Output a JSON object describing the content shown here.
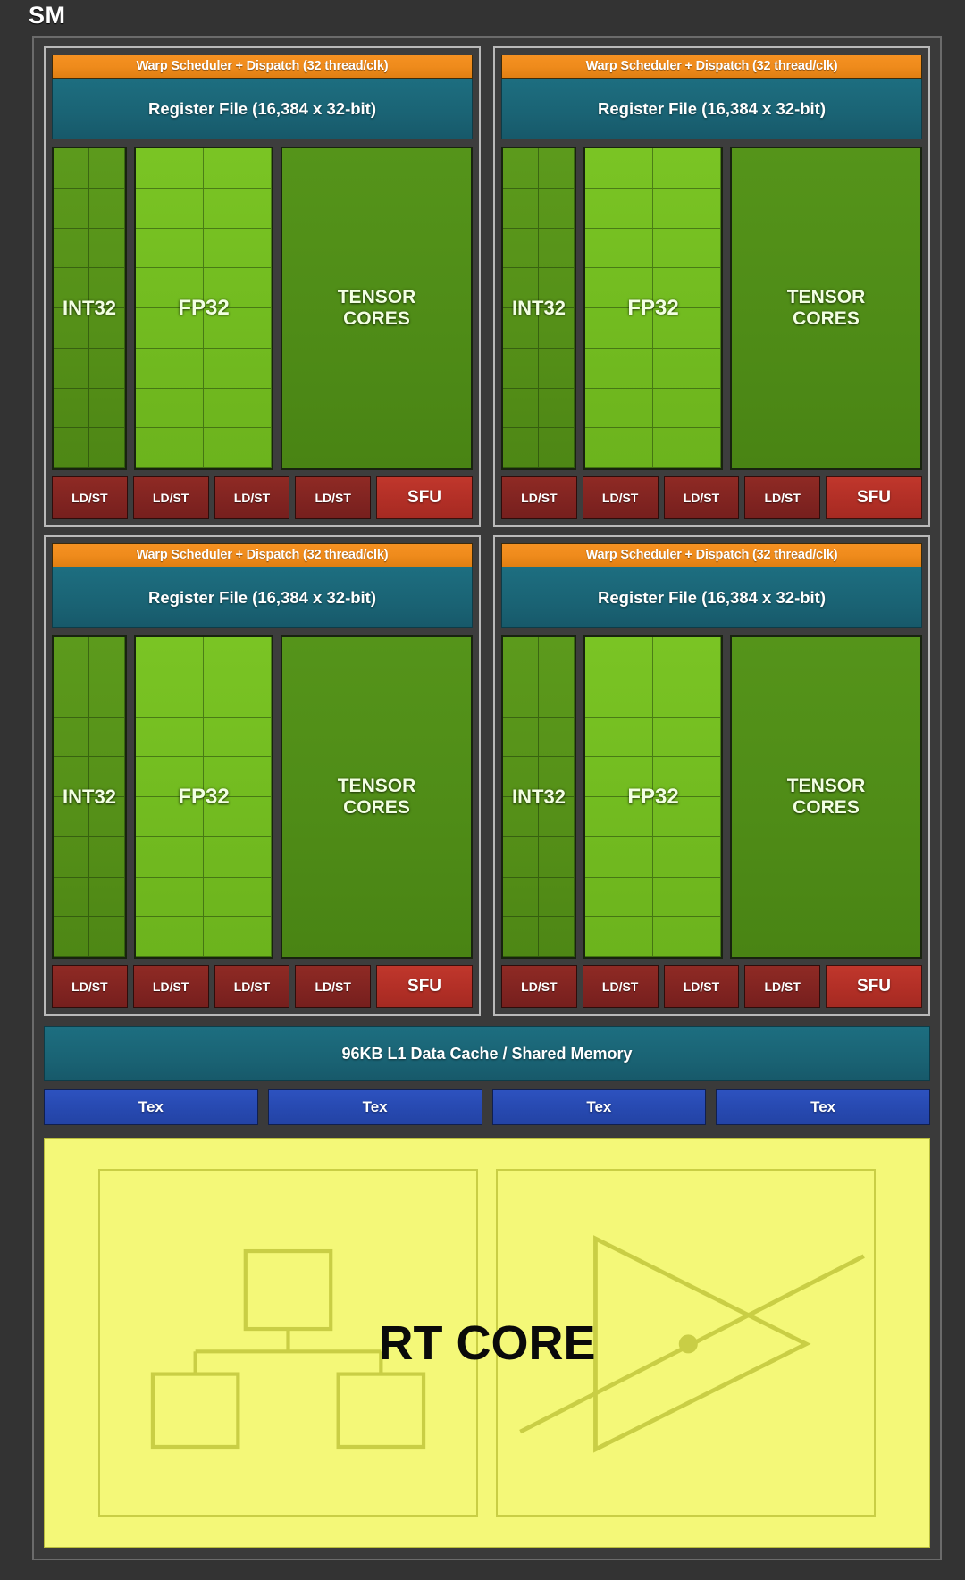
{
  "diagram": {
    "title": "SM",
    "subtitle": "",
    "processing_blocks": [
      {
        "warp_scheduler": "Warp Scheduler + Dispatch (32 thread/clk)",
        "register_file": "Register File (16,384 x 32-bit)",
        "units": [
          {
            "label": "INT32",
            "kind": "int32",
            "rows": 8,
            "cols": 2
          },
          {
            "label": "FP32",
            "kind": "fp32",
            "rows": 8,
            "cols": 2
          },
          {
            "label": "TENSOR\nCORES",
            "label_line1": "TENSOR",
            "label_line2": "CORES",
            "kind": "tensor",
            "rows": 0,
            "cols": 0
          }
        ],
        "ldst": [
          "LD/ST",
          "LD/ST",
          "LD/ST",
          "LD/ST"
        ],
        "sfu": "SFU"
      },
      {
        "warp_scheduler": "Warp Scheduler + Dispatch (32 thread/clk)",
        "register_file": "Register File (16,384 x 32-bit)",
        "units": [
          {
            "label": "INT32",
            "kind": "int32",
            "rows": 8,
            "cols": 2
          },
          {
            "label": "FP32",
            "kind": "fp32",
            "rows": 8,
            "cols": 2
          },
          {
            "label_line1": "TENSOR",
            "label_line2": "CORES",
            "kind": "tensor",
            "rows": 0,
            "cols": 0
          }
        ],
        "ldst": [
          "LD/ST",
          "LD/ST",
          "LD/ST",
          "LD/ST"
        ],
        "sfu": "SFU"
      },
      {
        "warp_scheduler": "Warp Scheduler + Dispatch (32 thread/clk)",
        "register_file": "Register File (16,384 x 32-bit)",
        "units": [
          {
            "label": "INT32",
            "kind": "int32",
            "rows": 8,
            "cols": 2
          },
          {
            "label": "FP32",
            "kind": "fp32",
            "rows": 8,
            "cols": 2
          },
          {
            "label_line1": "TENSOR",
            "label_line2": "CORES",
            "kind": "tensor",
            "rows": 0,
            "cols": 0
          }
        ],
        "ldst": [
          "LD/ST",
          "LD/ST",
          "LD/ST",
          "LD/ST"
        ],
        "sfu": "SFU"
      },
      {
        "warp_scheduler": "Warp Scheduler + Dispatch (32 thread/clk)",
        "register_file": "Register File (16,384 x 32-bit)",
        "units": [
          {
            "label": "INT32",
            "kind": "int32",
            "rows": 8,
            "cols": 2
          },
          {
            "label": "FP32",
            "kind": "fp32",
            "rows": 8,
            "cols": 2
          },
          {
            "label_line1": "TENSOR",
            "label_line2": "CORES",
            "kind": "tensor",
            "rows": 0,
            "cols": 0
          }
        ],
        "ldst": [
          "LD/ST",
          "LD/ST",
          "LD/ST",
          "LD/ST"
        ],
        "sfu": "SFU"
      }
    ],
    "l1_cache": "96KB L1 Data Cache / Shared Memory",
    "tex_units": [
      "Tex",
      "Tex",
      "Tex",
      "Tex"
    ],
    "rt_core": {
      "label": "RT CORE",
      "left_icon": "bvh-tree-icon",
      "right_icon": "ray-triangle-intersection-icon"
    },
    "colors": {
      "background": "#333333",
      "frame_border": "#6b6b6b",
      "warp_scheduler": "#ef8b1c",
      "register_file": "#1a6374",
      "int32": "#559018",
      "fp32": "#72bb20",
      "tensor_cores": "#4f8c17",
      "ldst": "#812421",
      "sfu": "#b22f26",
      "l1_cache": "#1a6374",
      "tex": "#2749b0",
      "rt_core": "#f4f878",
      "text_light": "#ffffff",
      "rt_core_text": "#0a0a0a"
    }
  }
}
